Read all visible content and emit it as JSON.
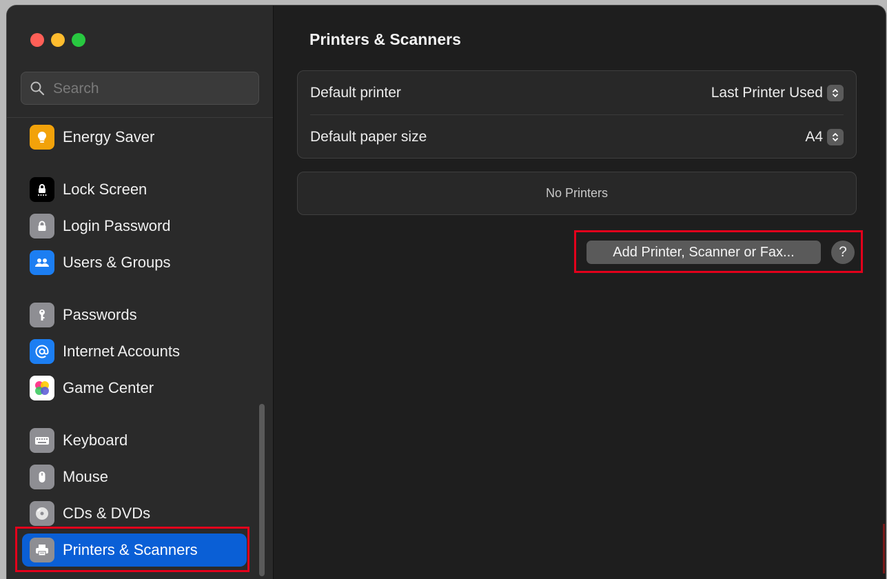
{
  "window": {
    "controls": [
      "close",
      "minimize",
      "zoom"
    ]
  },
  "search": {
    "placeholder": "Search",
    "value": ""
  },
  "sidebar": {
    "items": [
      {
        "label": "Energy Saver",
        "icon": "lightbulb-icon",
        "color": "#f2a20a"
      },
      {
        "label": "Lock Screen",
        "icon": "lock-screen-icon",
        "color": "#000000"
      },
      {
        "label": "Login Password",
        "icon": "padlock-icon",
        "color": "#8e8e93"
      },
      {
        "label": "Users & Groups",
        "icon": "users-icon",
        "color": "#1c7ef2"
      },
      {
        "label": "Passwords",
        "icon": "key-icon",
        "color": "#8e8e93"
      },
      {
        "label": "Internet Accounts",
        "icon": "at-sign-icon",
        "color": "#1c7ef2"
      },
      {
        "label": "Game Center",
        "icon": "game-center-icon",
        "color": "#ffffff"
      },
      {
        "label": "Keyboard",
        "icon": "keyboard-icon",
        "color": "#8e8e93"
      },
      {
        "label": "Mouse",
        "icon": "mouse-icon",
        "color": "#8e8e93"
      },
      {
        "label": "CDs & DVDs",
        "icon": "disc-icon",
        "color": "#8e8e93"
      },
      {
        "label": "Printers & Scanners",
        "icon": "printer-icon",
        "color": "#8e8e93",
        "selected": true
      }
    ]
  },
  "main": {
    "title": "Printers & Scanners",
    "settings": [
      {
        "label": "Default printer",
        "value": "Last Printer Used"
      },
      {
        "label": "Default paper size",
        "value": "A4"
      }
    ],
    "printers_empty": "No Printers",
    "add_button": "Add Printer, Scanner or Fax...",
    "help_button": "?"
  },
  "colors": {
    "accent": "#0a5fd6",
    "highlight": "#e3001b"
  }
}
